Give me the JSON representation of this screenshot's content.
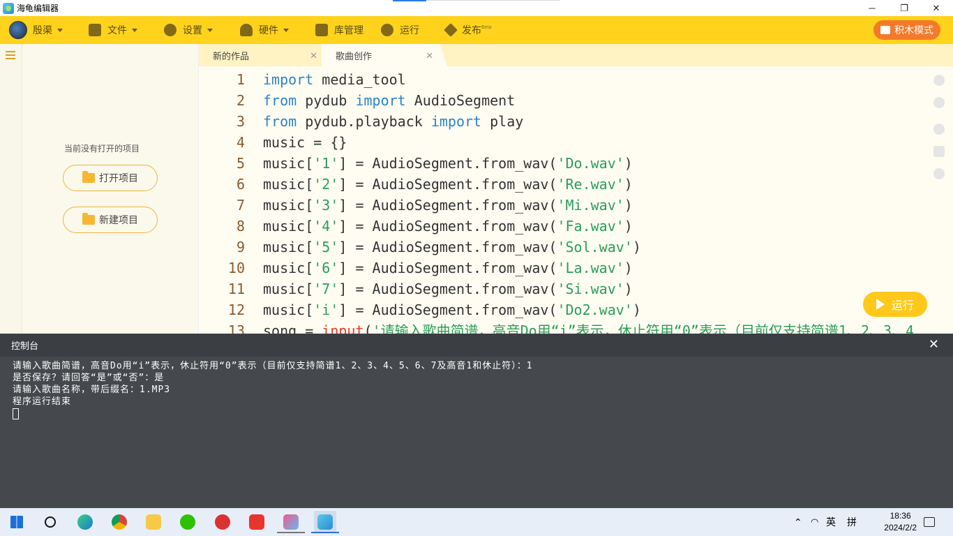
{
  "window": {
    "title": "海龟编辑器",
    "minimize": "─",
    "maximize": "❐",
    "close": "✕"
  },
  "toolbar": {
    "user": "殷渠",
    "file": "文件",
    "settings": "设置",
    "hardware": "硬件",
    "library": "库管理",
    "run": "运行",
    "publish": "发布",
    "publish_badge": "Beta",
    "blocks_mode": "积木模式"
  },
  "sidebar": {
    "empty_text": "当前没有打开的项目",
    "open_project": "打开项目",
    "new_project": "新建项目"
  },
  "tabs": [
    {
      "label": "新的作品",
      "close": "✕"
    },
    {
      "label": "歌曲创作",
      "close": "✕"
    }
  ],
  "code": [
    {
      "n": "1",
      "t": [
        [
          "kw",
          "import"
        ],
        [
          "plain",
          " media_tool"
        ]
      ]
    },
    {
      "n": "2",
      "t": [
        [
          "kw",
          "from"
        ],
        [
          "plain",
          " pydub "
        ],
        [
          "kw",
          "import"
        ],
        [
          "plain",
          " AudioSegment"
        ]
      ]
    },
    {
      "n": "3",
      "t": [
        [
          "kw",
          "from"
        ],
        [
          "plain",
          " pydub.playback "
        ],
        [
          "kw",
          "import"
        ],
        [
          "plain",
          " play"
        ]
      ]
    },
    {
      "n": "4",
      "t": [
        [
          "plain",
          "music = {}"
        ]
      ]
    },
    {
      "n": "5",
      "t": [
        [
          "plain",
          "music["
        ],
        [
          "str",
          "'1'"
        ],
        [
          "plain",
          "] = AudioSegment.from_wav("
        ],
        [
          "str",
          "'Do.wav'"
        ],
        [
          "plain",
          ")"
        ]
      ]
    },
    {
      "n": "6",
      "t": [
        [
          "plain",
          "music["
        ],
        [
          "str",
          "'2'"
        ],
        [
          "plain",
          "] = AudioSegment.from_wav("
        ],
        [
          "str",
          "'Re.wav'"
        ],
        [
          "plain",
          ")"
        ]
      ]
    },
    {
      "n": "7",
      "t": [
        [
          "plain",
          "music["
        ],
        [
          "str",
          "'3'"
        ],
        [
          "plain",
          "] = AudioSegment.from_wav("
        ],
        [
          "str",
          "'Mi.wav'"
        ],
        [
          "plain",
          ")"
        ]
      ]
    },
    {
      "n": "8",
      "t": [
        [
          "plain",
          "music["
        ],
        [
          "str",
          "'4'"
        ],
        [
          "plain",
          "] = AudioSegment.from_wav("
        ],
        [
          "str",
          "'Fa.wav'"
        ],
        [
          "plain",
          ")"
        ]
      ]
    },
    {
      "n": "9",
      "t": [
        [
          "plain",
          "music["
        ],
        [
          "str",
          "'5'"
        ],
        [
          "plain",
          "] = AudioSegment.from_wav("
        ],
        [
          "str",
          "'Sol.wav'"
        ],
        [
          "plain",
          ")"
        ]
      ]
    },
    {
      "n": "10",
      "t": [
        [
          "plain",
          "music["
        ],
        [
          "str",
          "'6'"
        ],
        [
          "plain",
          "] = AudioSegment.from_wav("
        ],
        [
          "str",
          "'La.wav'"
        ],
        [
          "plain",
          ")"
        ]
      ]
    },
    {
      "n": "11",
      "t": [
        [
          "plain",
          "music["
        ],
        [
          "str",
          "'7'"
        ],
        [
          "plain",
          "] = AudioSegment.from_wav("
        ],
        [
          "str",
          "'Si.wav'"
        ],
        [
          "plain",
          ")"
        ]
      ]
    },
    {
      "n": "12",
      "t": [
        [
          "plain",
          "music["
        ],
        [
          "str",
          "'i'"
        ],
        [
          "plain",
          "] = AudioSegment.from_wav("
        ],
        [
          "str",
          "'Do2.wav'"
        ],
        [
          "plain",
          ")"
        ]
      ]
    },
    {
      "n": "13",
      "t": [
        [
          "plain",
          "song = "
        ],
        [
          "bi",
          "input"
        ],
        [
          "plain",
          "("
        ],
        [
          "str",
          "'请输入歌曲简谱，高音Do用“i”表示，休止符用“0”表示（目前仅支持简谱1、2、3、4"
        ]
      ]
    }
  ],
  "run_button": "运行",
  "console": {
    "title": "控制台",
    "close": "✕",
    "lines": [
      "请输入歌曲简谱，高音Do用“i”表示，休止符用“0”表示（目前仅支持简谱1、2、3、4、5、6、7及高音1和休止符）：1",
      "是否保存？请回答“是”或“否”：是",
      "请输入歌曲名称，带后缀名：1.MP3",
      "程序运行结束"
    ]
  },
  "taskbar": {
    "ime_lang": "英",
    "ime_mode": "拼",
    "time": "18:36",
    "date": "2024/2/2"
  }
}
